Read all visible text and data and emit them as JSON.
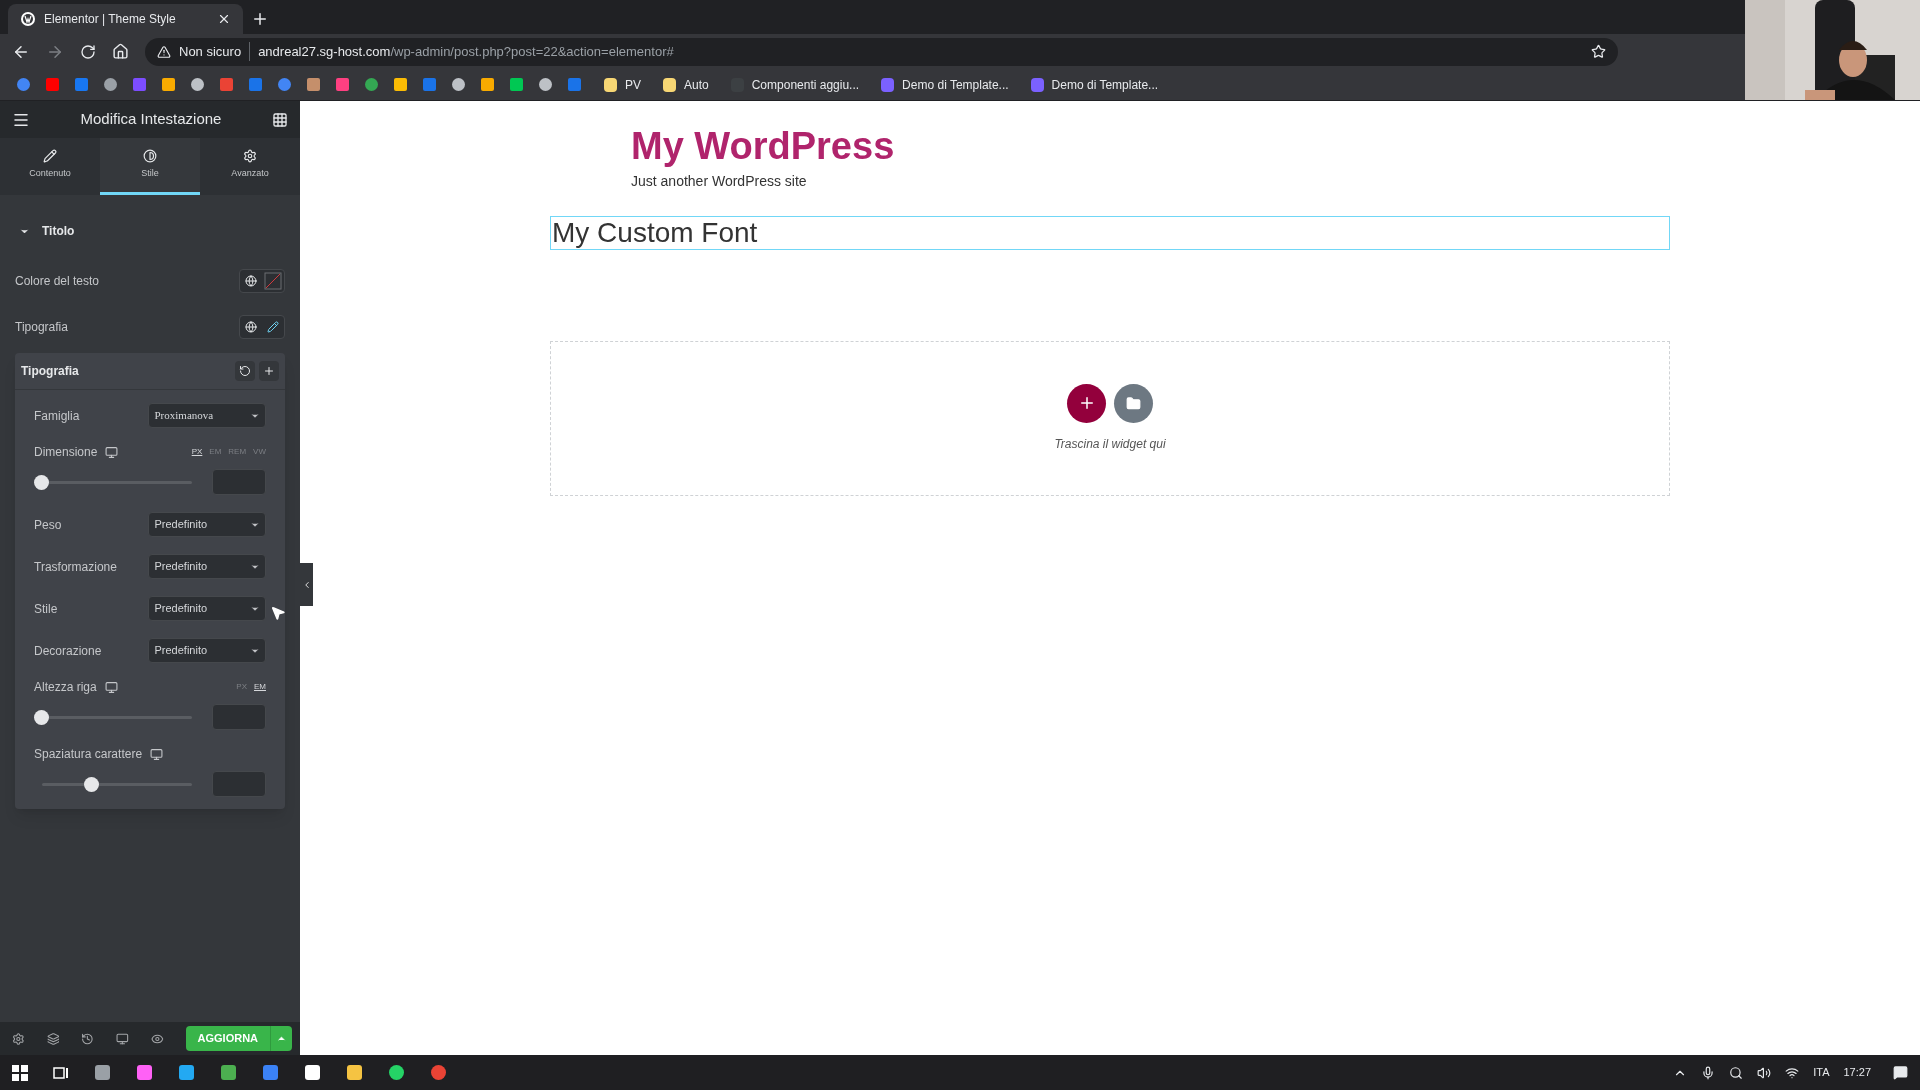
{
  "browser": {
    "tab": {
      "title": "Elementor | Theme Style"
    },
    "address": {
      "security": "Non sicuro",
      "host": "andreal27.sg-host.com",
      "path": "/wp-admin/post.php?post=22&action=elementor#"
    },
    "bookmarks": [
      {
        "label": "PV"
      },
      {
        "label": "Auto"
      },
      {
        "label": "Componenti aggiu..."
      },
      {
        "label": "Demo di Template..."
      },
      {
        "label": "Demo di Template..."
      }
    ]
  },
  "panel": {
    "title": "Modifica Intestazione",
    "tabs": [
      {
        "label": "Contenuto",
        "selected": false
      },
      {
        "label": "Stile",
        "selected": true
      },
      {
        "label": "Avanzato",
        "selected": false
      }
    ],
    "section": {
      "title": "Titolo",
      "expanded": true
    },
    "controls": [
      {
        "label": "Colore del testo",
        "kind": "color"
      },
      {
        "label": "Tipografia",
        "kind": "typography"
      }
    ],
    "popover": {
      "title": "Tipografia",
      "fields": [
        {
          "kind": "select",
          "label": "Famiglia",
          "value": "Proximanova"
        },
        {
          "kind": "slider",
          "label": "Dimensione",
          "units": [
            {
              "label": "PX",
              "selected": true
            },
            {
              "label": "EM",
              "selected": false
            },
            {
              "label": "REM",
              "selected": false
            },
            {
              "label": "VW",
              "selected": false
            }
          ],
          "level": 0
        },
        {
          "kind": "select",
          "label": "Peso",
          "value": "Predefinito"
        },
        {
          "kind": "select",
          "label": "Trasformazione",
          "value": "Predefinito"
        },
        {
          "kind": "select",
          "label": "Stile",
          "value": "Predefinito"
        },
        {
          "kind": "select",
          "label": "Decorazione",
          "value": "Predefinito"
        },
        {
          "kind": "slider",
          "label": "Altezza riga",
          "units": [
            {
              "label": "PX",
              "selected": false
            },
            {
              "label": "EM",
              "selected": true
            }
          ],
          "level": 0
        },
        {
          "kind": "slider",
          "label": "Spaziatura carattere",
          "level": 0.33
        }
      ]
    },
    "update_button": "AGGIORNA"
  },
  "canvas": {
    "site_title": "My WordPress",
    "tagline": "Just another WordPress site",
    "heading": "My Custom Font",
    "drop_hint": "Trascina il widget qui"
  },
  "taskbar": {
    "language": "ITA",
    "time": "17:27"
  }
}
